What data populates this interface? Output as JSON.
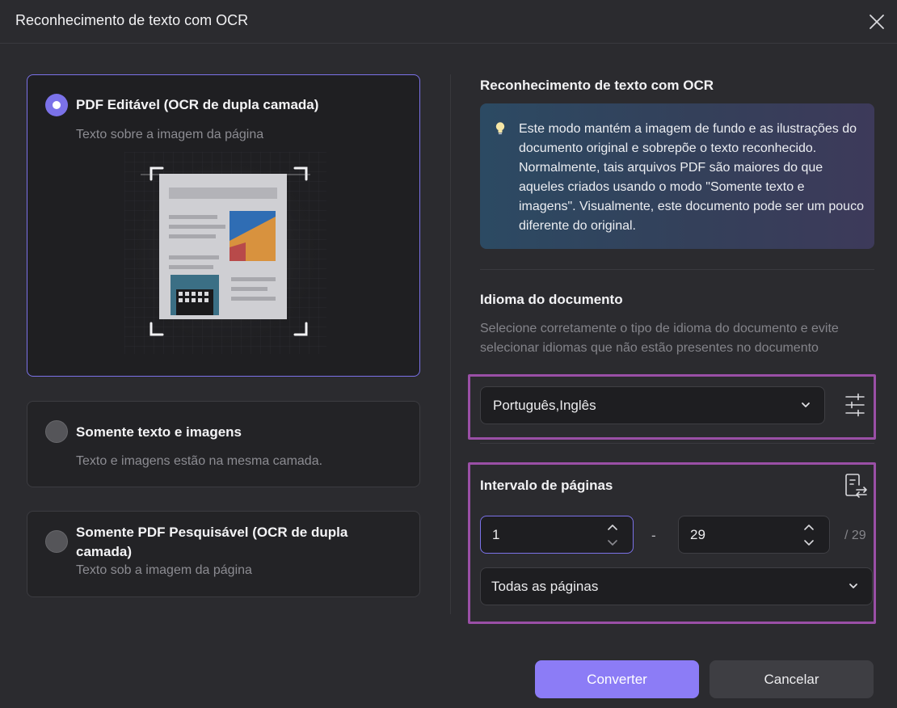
{
  "dialog": {
    "title": "Reconhecimento de texto com OCR"
  },
  "options": [
    {
      "title": "PDF Editável (OCR de dupla camada)",
      "description": "Texto sobre a imagem da página",
      "selected": true
    },
    {
      "title": "Somente texto e imagens",
      "description": "Texto e imagens estão na mesma camada.",
      "selected": false
    },
    {
      "title": "Somente PDF Pesquisável (OCR de dupla camada)",
      "description": "Texto sob a imagem da página",
      "selected": false
    }
  ],
  "ocr_section": {
    "title": "Reconhecimento de texto com OCR",
    "info": "Este modo mantém a imagem de fundo e as ilustrações do documento original e sobrepõe o texto reconhecido. Normalmente, tais arquivos PDF são maiores do que aqueles criados usando o modo \"Somente texto e imagens\". Visualmente, este documento pode ser um pouco diferente do original."
  },
  "language_section": {
    "title": "Idioma do documento",
    "helper": "Selecione corretamente o tipo de idioma do documento e evite selecionar idiomas que não estão presentes no documento",
    "selected": "Português,Inglês"
  },
  "page_range": {
    "title": "Intervalo de páginas",
    "from": "1",
    "to": "29",
    "separator": "-",
    "total": "/ 29",
    "mode": "Todas as páginas"
  },
  "buttons": {
    "convert": "Converter",
    "cancel": "Cancelar"
  },
  "colors": {
    "accent": "#7b72e9",
    "primary_button": "#8c7cf6",
    "highlight": "#9a4fa6"
  }
}
